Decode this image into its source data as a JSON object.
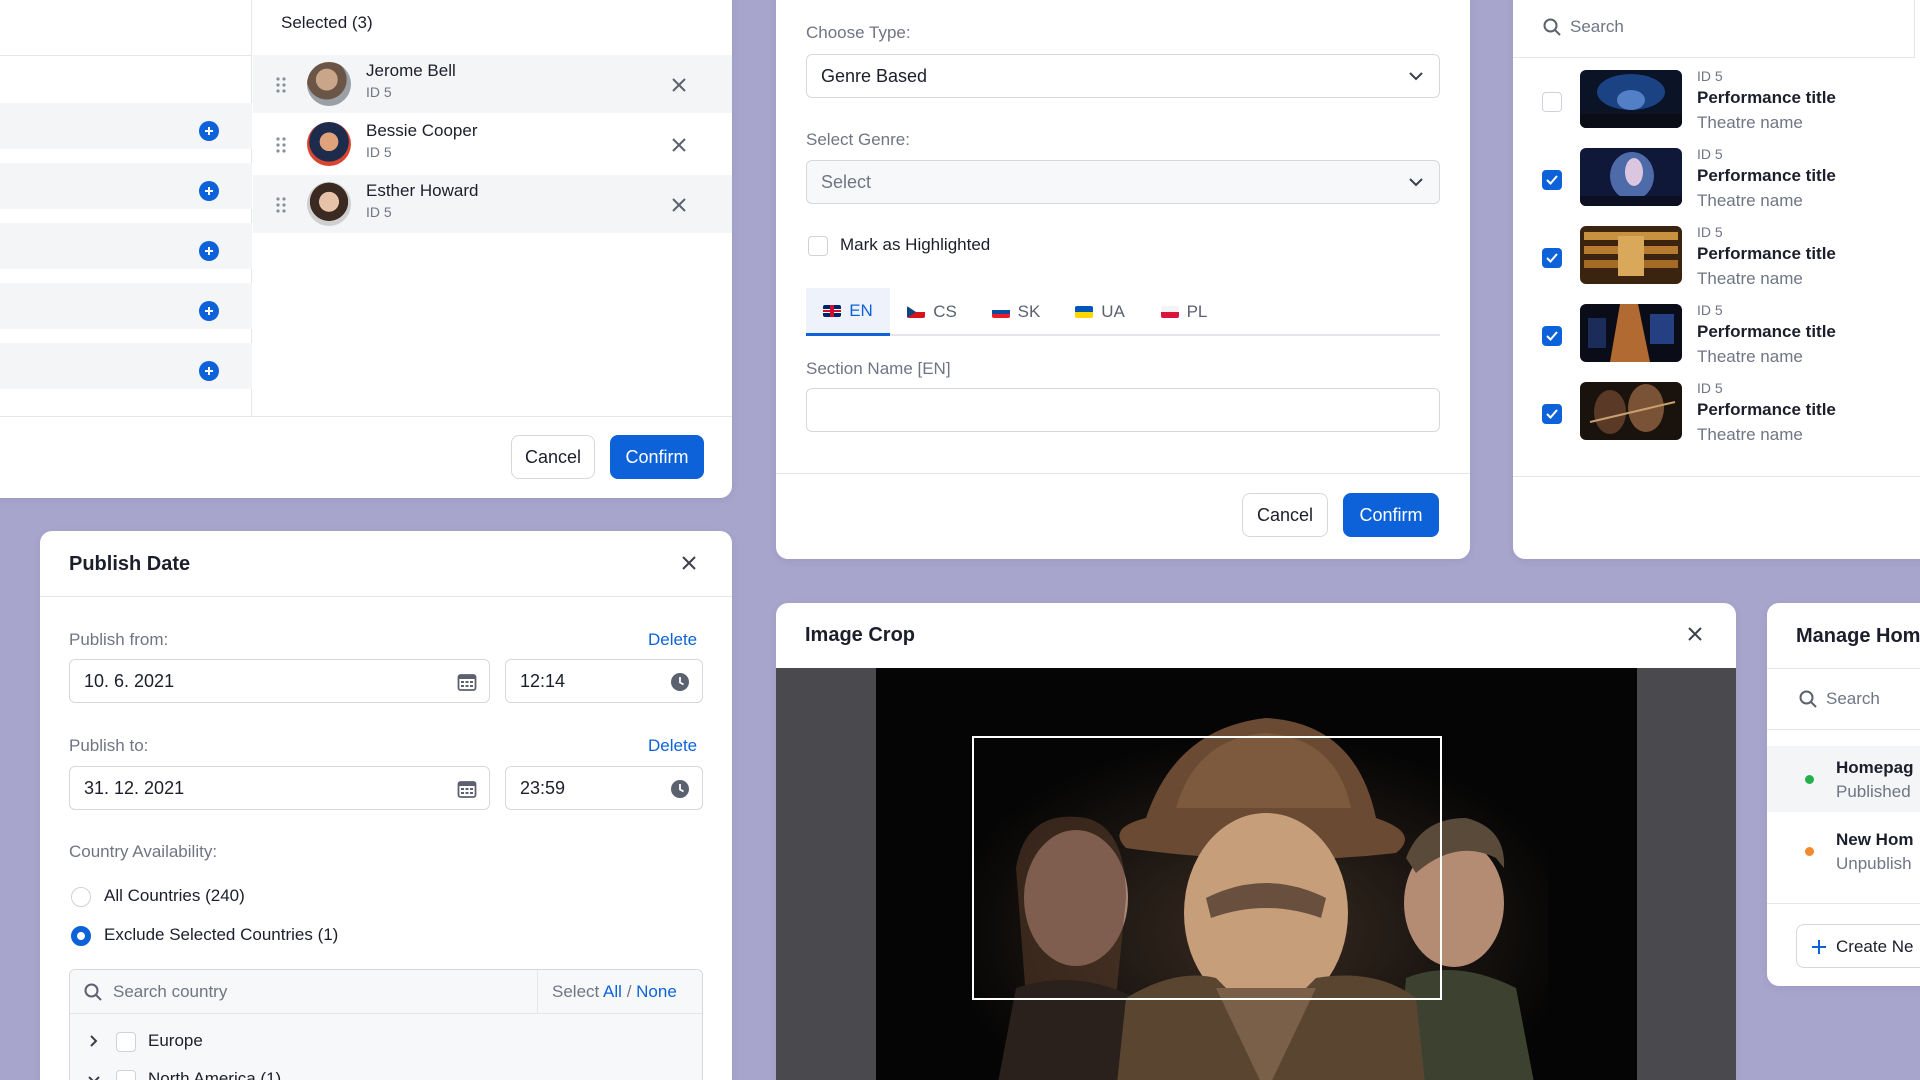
{
  "selected_panel": {
    "header": "Selected (3)",
    "people": [
      {
        "name": "Jerome Bell",
        "sub": "ID 5"
      },
      {
        "name": "Bessie Cooper",
        "sub": "ID 5"
      },
      {
        "name": "Esther Howard",
        "sub": "ID 5"
      }
    ],
    "cancel_label": "Cancel",
    "confirm_label": "Confirm"
  },
  "section_form": {
    "choose_type_label": "Choose Type:",
    "choose_type_value": "Genre Based",
    "select_genre_label": "Select Genre:",
    "select_genre_value": "Select",
    "highlight_label": "Mark as Highlighted",
    "lang_tabs": [
      {
        "code": "EN",
        "active": true
      },
      {
        "code": "CS",
        "active": false
      },
      {
        "code": "SK",
        "active": false
      },
      {
        "code": "UA",
        "active": false
      },
      {
        "code": "PL",
        "active": false
      }
    ],
    "section_name_label": "Section Name [EN]",
    "section_name_value": "",
    "cancel_label": "Cancel",
    "confirm_label": "Confirm"
  },
  "performances": {
    "search_placeholder": "Search",
    "items": [
      {
        "id": "ID 5",
        "title": "Performance title",
        "theatre": "Theatre name",
        "checked": false
      },
      {
        "id": "ID 5",
        "title": "Performance title",
        "theatre": "Theatre name",
        "checked": true
      },
      {
        "id": "ID 5",
        "title": "Performance title",
        "theatre": "Theatre name",
        "checked": true
      },
      {
        "id": "ID 5",
        "title": "Performance title",
        "theatre": "Theatre name",
        "checked": true
      },
      {
        "id": "ID 5",
        "title": "Performance title",
        "theatre": "Theatre name",
        "checked": true
      }
    ]
  },
  "publish_date": {
    "title": "Publish Date",
    "from_label": "Publish from:",
    "from_delete": "Delete",
    "from_date": "10. 6. 2021",
    "from_time": "12:14",
    "to_label": "Publish to:",
    "to_delete": "Delete",
    "to_date": "31. 12. 2021",
    "to_time": "23:59",
    "country_label": "Country Availability:",
    "opt_all": "All Countries (240)",
    "opt_exclude": "Exclude Selected Countries (1)",
    "country_search_placeholder": "Search country",
    "select_prefix": "Select",
    "select_all": "All",
    "select_sep": "/",
    "select_none": "None",
    "tree": [
      {
        "label": "Europe",
        "expanded": false
      },
      {
        "label": "North America (1)",
        "expanded": true
      }
    ]
  },
  "image_crop": {
    "title": "Image Crop"
  },
  "manage_home": {
    "title": "Manage Hom",
    "search_placeholder": "Search",
    "items": [
      {
        "name": "Homepag",
        "status": "Published",
        "color": "#22b14c"
      },
      {
        "name": "New Hom",
        "status": "Unpublish",
        "color": "#f08a2c"
      }
    ],
    "create_label": "Create Ne"
  },
  "colors": {
    "accent": "#0d62d9",
    "background": "#a7a5cc",
    "published": "#22b14c",
    "unpublished": "#f08a2c"
  }
}
